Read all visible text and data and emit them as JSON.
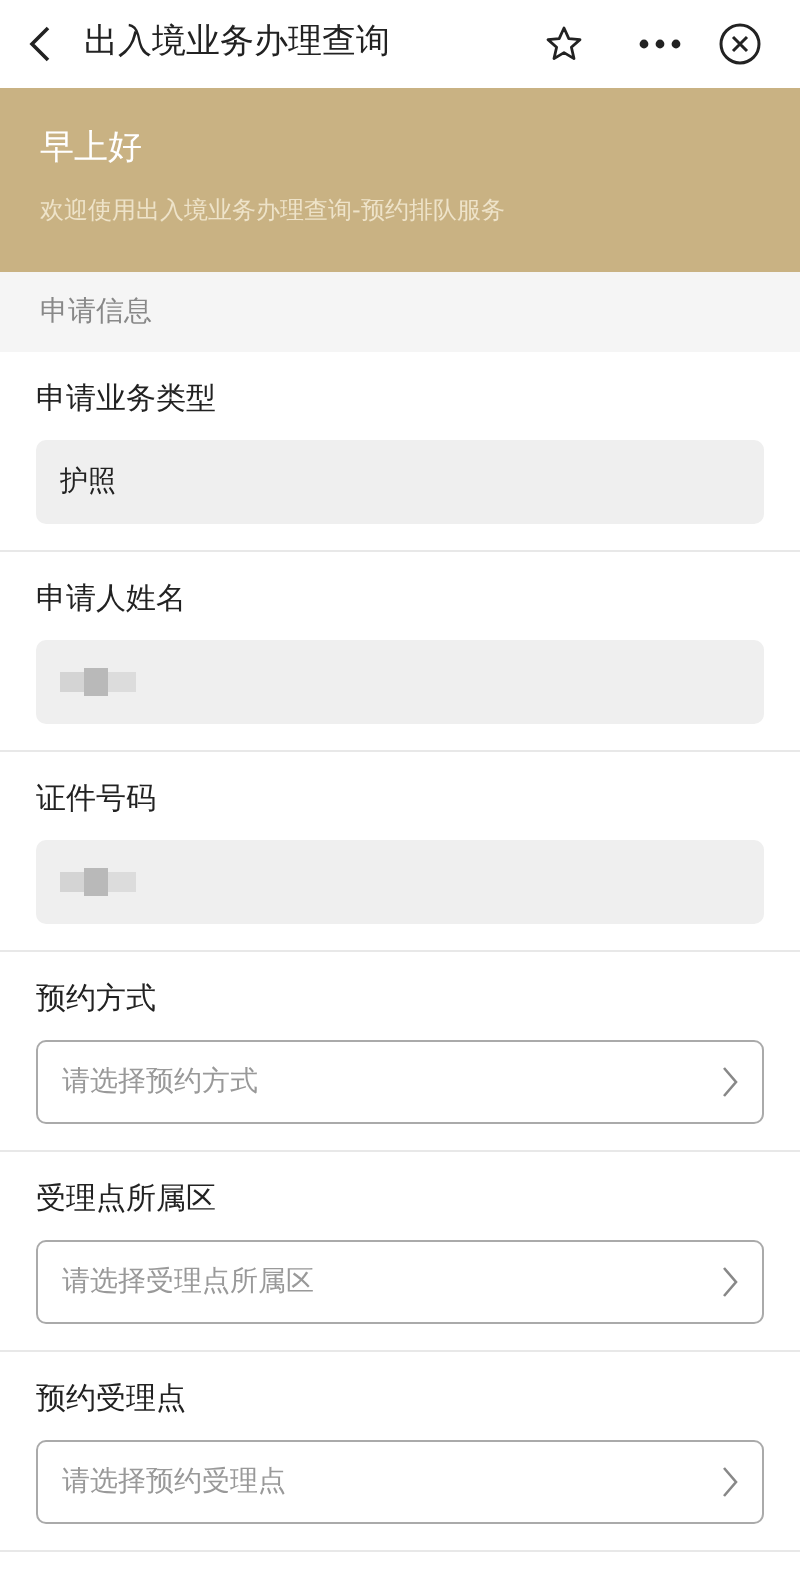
{
  "nav": {
    "title": "出入境业务办理查询"
  },
  "banner": {
    "greeting": "早上好",
    "subtitle": "欢迎使用出入境业务办理查询-预约排队服务"
  },
  "section_title": "申请信息",
  "fields": [
    {
      "label": "申请业务类型",
      "kind": "filled",
      "value": "护照"
    },
    {
      "label": "申请人姓名",
      "kind": "masked"
    },
    {
      "label": "证件号码",
      "kind": "masked"
    },
    {
      "label": "预约方式",
      "kind": "select",
      "placeholder": "请选择预约方式"
    },
    {
      "label": "受理点所属区",
      "kind": "select",
      "placeholder": "请选择受理点所属区"
    },
    {
      "label": "预约受理点",
      "kind": "select",
      "placeholder": "请选择预约受理点"
    }
  ]
}
